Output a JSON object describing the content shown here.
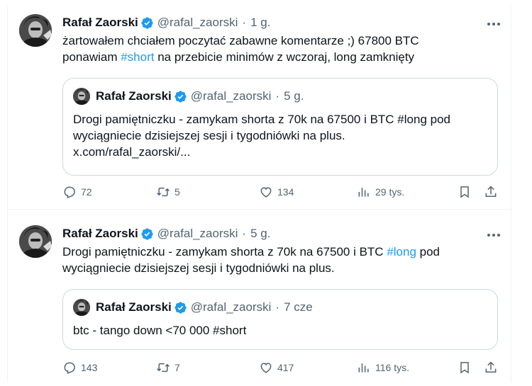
{
  "tweets": [
    {
      "author": "Rafał Zaorski",
      "handle": "@rafal_zaorski",
      "sep": "·",
      "time": "1 g.",
      "text_line1": "żartowałem chciałem poczytać zabawne komentarze ;) 67800 BTC",
      "text_line2_pre": "ponawiam ",
      "hashtag": "#short",
      "text_line2_post": " na przebicie minimów z wczoraj, long zamknięty",
      "quote": {
        "author": "Rafał Zaorski",
        "handle": "@rafal_zaorski",
        "sep": "·",
        "time": "5 g.",
        "line1": "Drogi pamiętniczku - zamykam shorta z 70k na 67500 i BTC #long pod",
        "line2": "wyciągniecie dzisiejszej sesji i tygodniówki na plus.",
        "line3": "x.com/rafal_zaorski/..."
      },
      "stats": {
        "replies": "72",
        "reposts": "5",
        "likes": "134",
        "views": "29 tys."
      }
    },
    {
      "author": "Rafał Zaorski",
      "handle": "@rafal_zaorski",
      "sep": "·",
      "time": "5 g.",
      "text_line1_pre": "Drogi pamiętniczku - zamykam shorta z 70k na 67500 i BTC ",
      "hashtag": "#long",
      "text_line1_post": " pod",
      "text_line2": "wyciągniecie dzisiejszej sesji i tygodniówki na plus.",
      "quote": {
        "author": "Rafał Zaorski",
        "handle": "@rafal_zaorski",
        "sep": "·",
        "time": "7 cze",
        "line1": "btc - tango down <70 000 #short"
      },
      "stats": {
        "replies": "143",
        "reposts": "7",
        "likes": "417",
        "views": "116 tys."
      }
    }
  ],
  "icons": {
    "verified": "verified-badge-icon",
    "more": "more-icon",
    "reply": "reply-icon",
    "repost": "repost-icon",
    "like": "heart-icon",
    "views": "views-icon",
    "bookmark": "bookmark-icon",
    "share": "share-icon"
  },
  "colors": {
    "accent": "#1d9bf0",
    "text": "#0f1419",
    "muted": "#536471",
    "border": "#cfd9de"
  }
}
